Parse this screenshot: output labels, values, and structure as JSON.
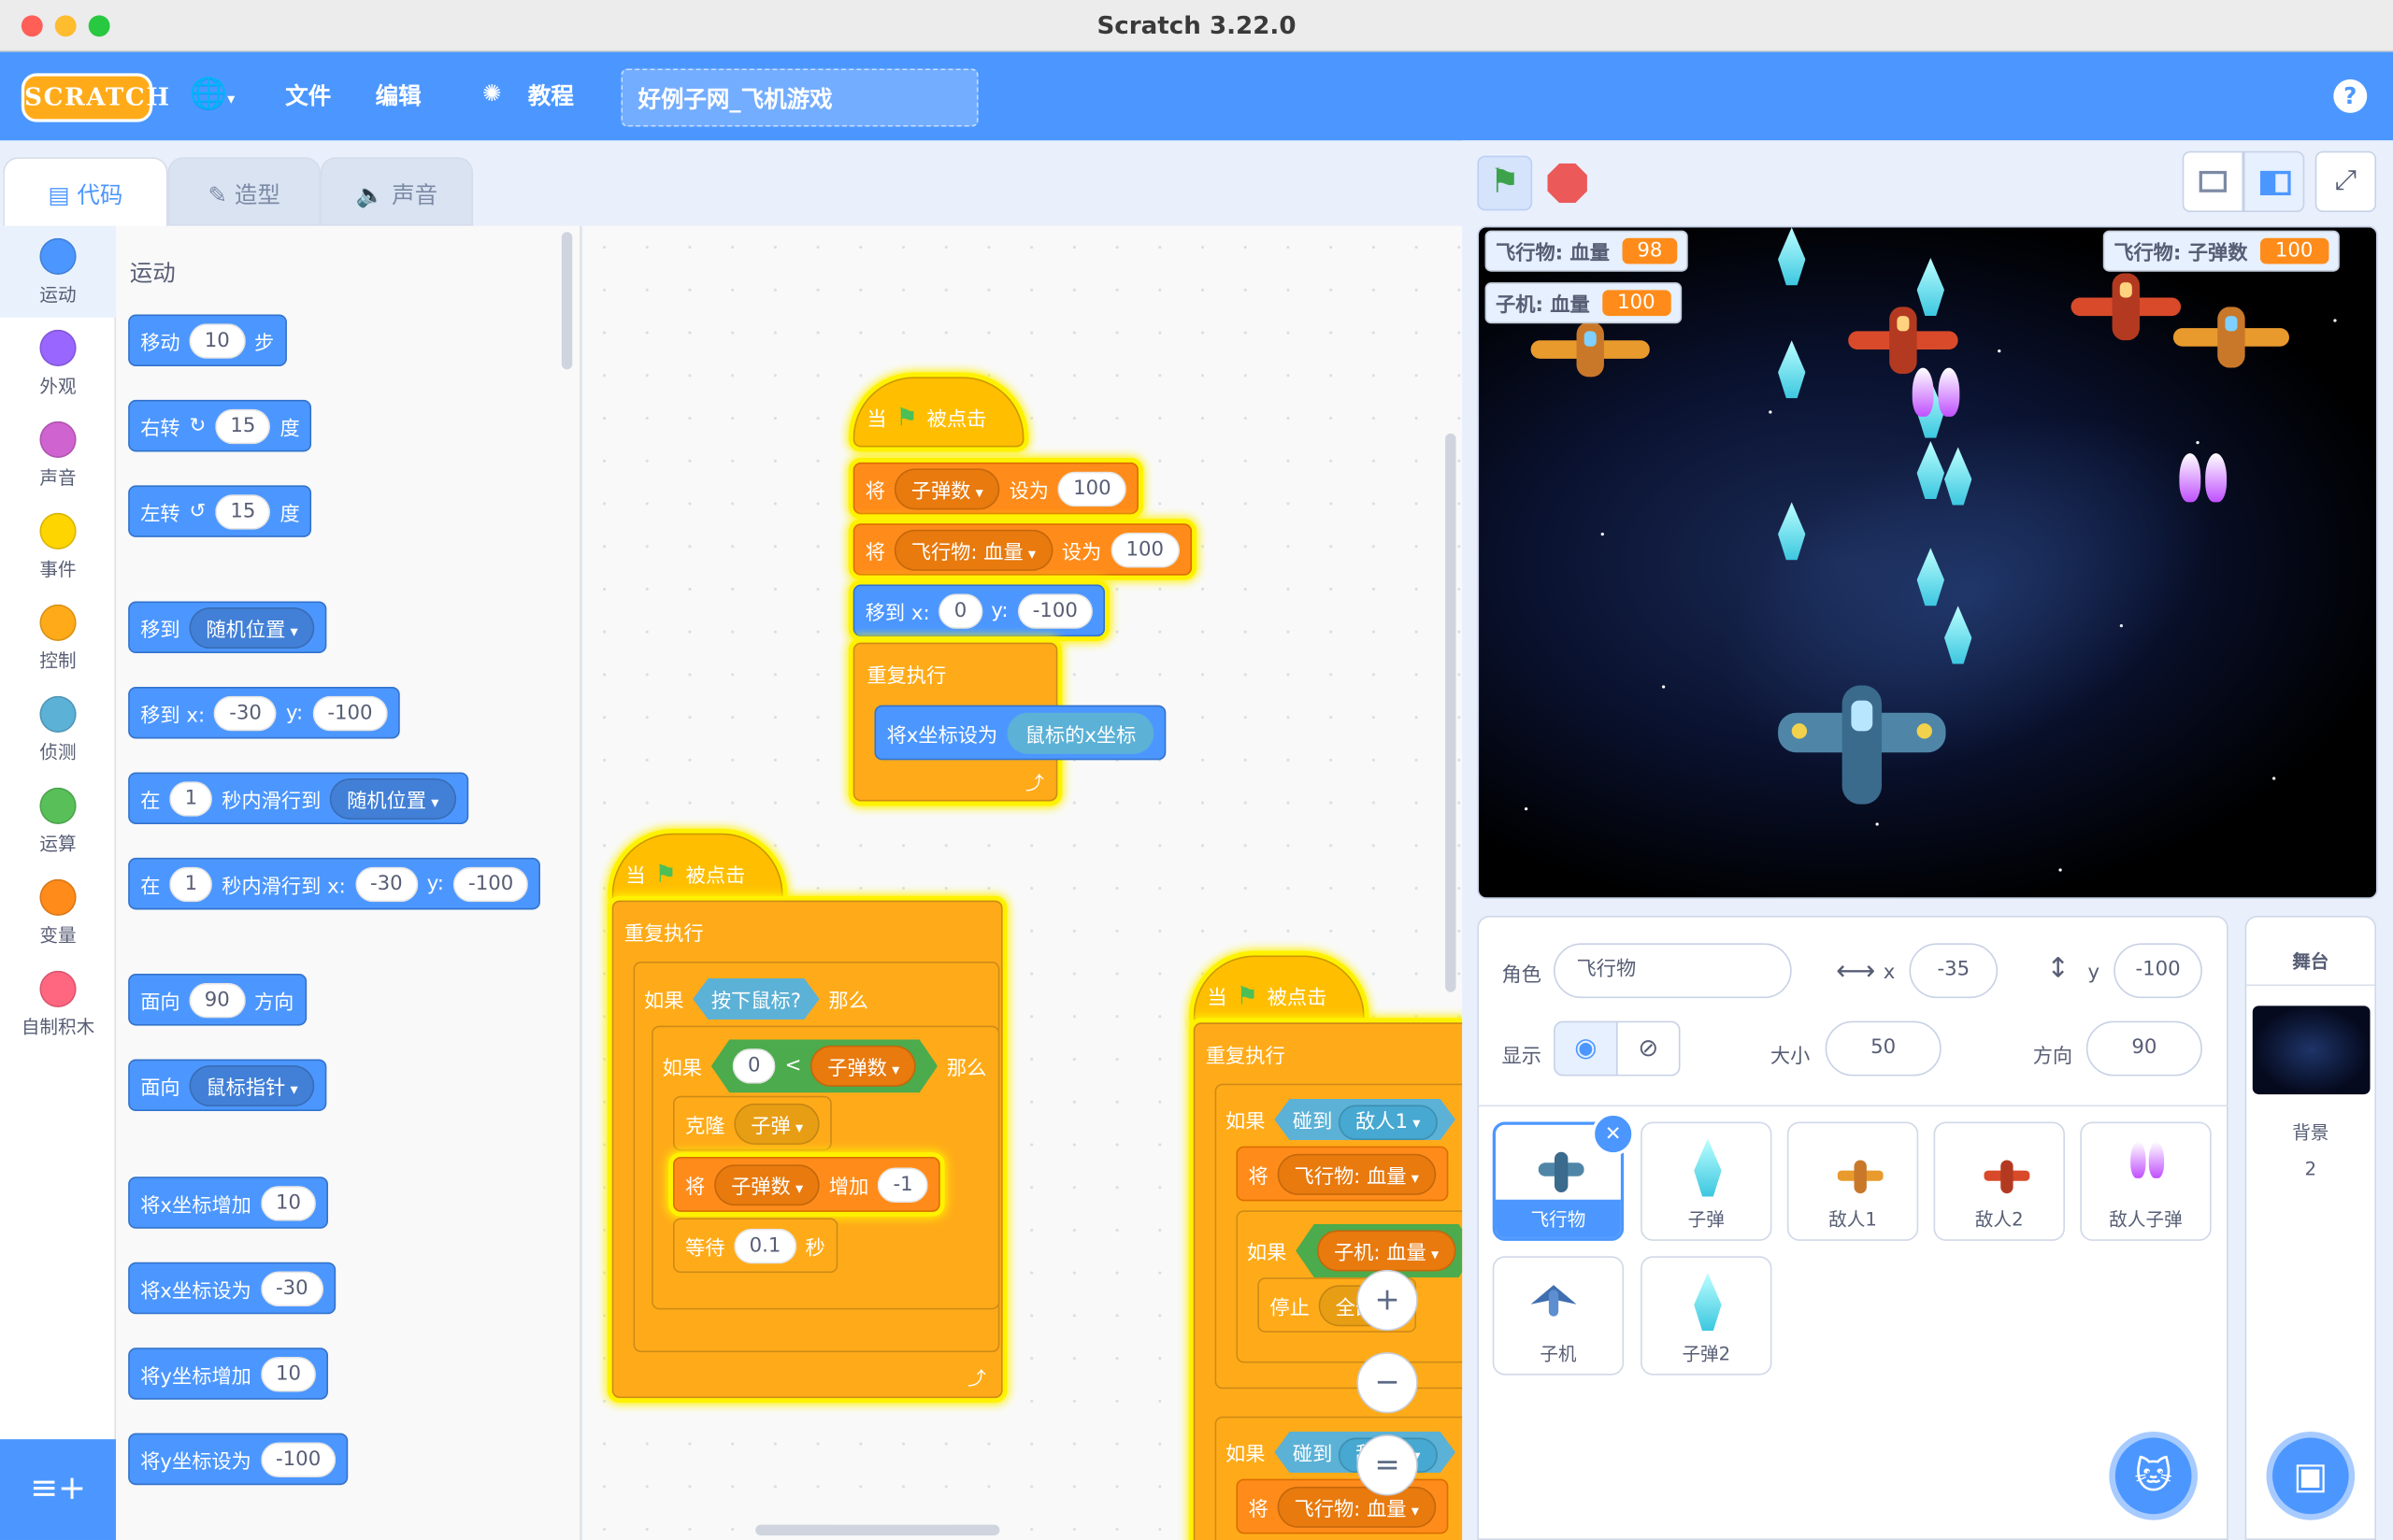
{
  "window": {
    "title": "Scratch 3.22.0"
  },
  "menu": {
    "logo": "SCRATCH",
    "file": "文件",
    "edit": "编辑",
    "tutorials": "教程",
    "project_title": "好例子网_飞机游戏",
    "help": "?"
  },
  "tabs": {
    "code": "代码",
    "costumes": "造型",
    "sounds": "声音"
  },
  "categories": [
    "运动",
    "外观",
    "声音",
    "事件",
    "控制",
    "侦测",
    "运算",
    "变量",
    "自制积木"
  ],
  "category_colors": [
    "#4c97ff",
    "#9966ff",
    "#cf63cf",
    "#ffd500",
    "#ffab19",
    "#5cb1d6",
    "#59c059",
    "#ff8c1a",
    "#ff6680"
  ],
  "palette": {
    "heading": "运动",
    "move": {
      "a": "移动",
      "n": "10",
      "b": "步"
    },
    "turn_right": {
      "a": "右转",
      "n": "15",
      "b": "度"
    },
    "turn_left": {
      "a": "左转",
      "n": "15",
      "b": "度"
    },
    "goto": {
      "a": "移到",
      "d": "随机位置"
    },
    "goto_xy": {
      "a": "移到 x:",
      "x": "-30",
      "b": "y:",
      "y": "-100"
    },
    "glide": {
      "a": "在",
      "n": "1",
      "b": "秒内滑行到",
      "d": "随机位置"
    },
    "glide_xy": {
      "a": "在",
      "n": "1",
      "b": "秒内滑行到 x:",
      "x": "-30",
      "c": "y:",
      "y": "-100"
    },
    "point_dir": {
      "a": "面向",
      "n": "90",
      "b": "方向"
    },
    "point_towards": {
      "a": "面向",
      "d": "鼠标指针"
    },
    "change_x": {
      "a": "将x坐标增加",
      "n": "10"
    },
    "set_x": {
      "a": "将x坐标设为",
      "n": "-30"
    },
    "change_y": {
      "a": "将y坐标增加",
      "n": "10"
    },
    "set_y": {
      "a": "将y坐标设为",
      "n": "-100"
    }
  },
  "script1": {
    "hat": {
      "a": "当",
      "b": "被点击"
    },
    "set1": {
      "a": "将",
      "var": "子弹数",
      "b": "设为",
      "val": "100"
    },
    "set2": {
      "a": "将",
      "var": "飞行物: 血量",
      "b": "设为",
      "val": "100"
    },
    "goto": {
      "a": "移到 x:",
      "x": "0",
      "b": "y:",
      "y": "-100"
    },
    "forever": "重复执行",
    "setx": {
      "a": "将x坐标设为",
      "rep": "鼠标的x坐标"
    }
  },
  "script2": {
    "hat": {
      "a": "当",
      "b": "被点击"
    },
    "forever": "重复执行",
    "if1": {
      "a": "如果",
      "cond": "按下鼠标?",
      "b": "那么"
    },
    "if2": {
      "a": "如果",
      "l": "0",
      "op": "<",
      "r": "子弹数",
      "b": "那么"
    },
    "clone": {
      "a": "克隆",
      "d": "子弹"
    },
    "change": {
      "a": "将",
      "var": "子弹数",
      "b": "增加",
      "val": "-1"
    },
    "wait": {
      "a": "等待",
      "n": "0.1",
      "b": "秒"
    }
  },
  "script3": {
    "hat": {
      "a": "当",
      "b": "被点击"
    },
    "forever": "重复执行",
    "if1": {
      "a": "如果",
      "b": "碰到",
      "d": "敌人1"
    },
    "set": {
      "a": "将",
      "var": "飞行物: 血量"
    },
    "if2": {
      "a": "如果",
      "rep": "子机: 血量"
    },
    "stop": {
      "a": "停止",
      "d": "全部"
    },
    "if3": {
      "a": "如果",
      "b": "碰到",
      "d": "敌人2"
    },
    "set2": {
      "a": "将",
      "var": "飞行物: 血量"
    }
  },
  "zoom": {
    "in": "+",
    "out": "−",
    "reset": "="
  },
  "stage": {
    "monitors": [
      {
        "label": "飞行物: 血量",
        "value": "98"
      },
      {
        "label": "子机: 血量",
        "value": "100"
      },
      {
        "label": "飞行物: 子弹数",
        "value": "100"
      }
    ]
  },
  "sprite_info": {
    "sprite_label": "角色",
    "sprite_name": "飞行物",
    "x_label": "x",
    "x": "-35",
    "y_label": "y",
    "y": "-100",
    "show_label": "显示",
    "size_label": "大小",
    "size": "50",
    "direction_label": "方向",
    "direction": "90"
  },
  "sprites": [
    "飞行物",
    "子弹",
    "敌人1",
    "敌人2",
    "敌人子弹",
    "子机",
    "子弹2"
  ],
  "stage_pane": {
    "title": "舞台",
    "backdrops_label": "背景",
    "backdrops_count": "2"
  }
}
